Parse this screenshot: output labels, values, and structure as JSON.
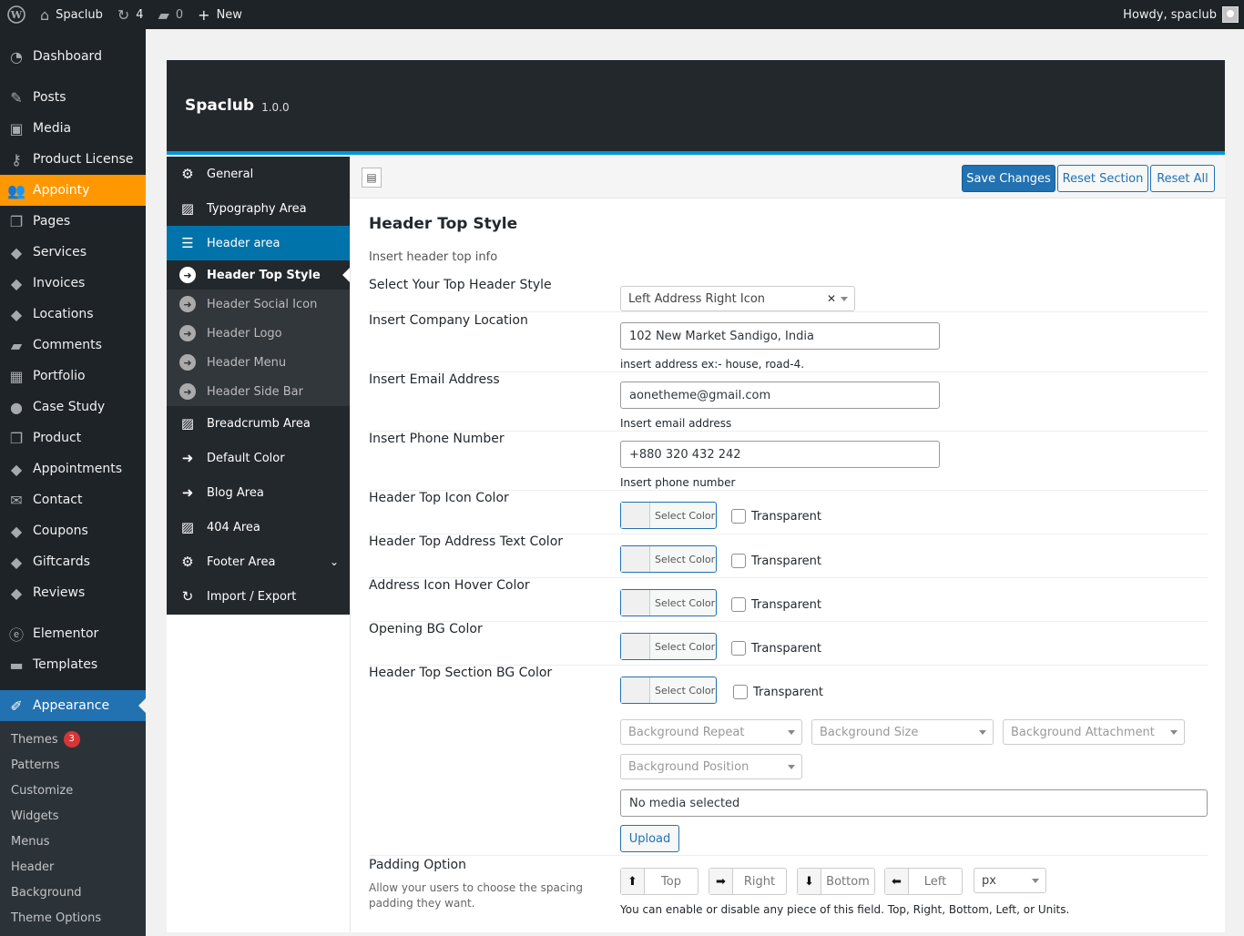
{
  "adminbar": {
    "site_name": "Spaclub",
    "updates_count": "4",
    "comments_count": "0",
    "new_label": "New",
    "howdy": "Howdy, spaclub"
  },
  "admin_menu": {
    "items": [
      {
        "label": "Dashboard",
        "icon": "dashboard-icon"
      },
      {
        "label": "Posts",
        "icon": "pin-icon"
      },
      {
        "label": "Media",
        "icon": "media-icon"
      },
      {
        "label": "Product License",
        "icon": "key-icon"
      },
      {
        "label": "Appointy",
        "icon": "users-icon"
      },
      {
        "label": "Pages",
        "icon": "pages-icon"
      },
      {
        "label": "Services",
        "icon": "tag-icon"
      },
      {
        "label": "Invoices",
        "icon": "tag-icon"
      },
      {
        "label": "Locations",
        "icon": "tag-icon"
      },
      {
        "label": "Comments",
        "icon": "comment-icon"
      },
      {
        "label": "Portfolio",
        "icon": "portfolio-icon"
      },
      {
        "label": "Case Study",
        "icon": "chat-icon"
      },
      {
        "label": "Product",
        "icon": "pages-icon"
      },
      {
        "label": "Appointments",
        "icon": "tag-icon"
      },
      {
        "label": "Contact",
        "icon": "mail-icon"
      },
      {
        "label": "Coupons",
        "icon": "tag-icon"
      },
      {
        "label": "Giftcards",
        "icon": "tag-icon"
      },
      {
        "label": "Reviews",
        "icon": "tag-icon"
      },
      {
        "label": "Elementor",
        "icon": "elementor-icon"
      },
      {
        "label": "Templates",
        "icon": "folder-icon"
      },
      {
        "label": "Appearance",
        "icon": "brush-icon"
      }
    ],
    "submenu": [
      {
        "label": "Themes",
        "badge": "3"
      },
      {
        "label": "Patterns"
      },
      {
        "label": "Customize"
      },
      {
        "label": "Widgets"
      },
      {
        "label": "Menus"
      },
      {
        "label": "Header"
      },
      {
        "label": "Background"
      },
      {
        "label": "Theme Options"
      }
    ]
  },
  "panel": {
    "title": "Spaclub",
    "version": "1.0.0",
    "sidebar": {
      "general": "General",
      "typography": "Typography Area",
      "header_area": "Header area",
      "sub": [
        "Header Top Style",
        "Header Social Icon",
        "Header Logo",
        "Header Menu",
        "Header Side Bar"
      ],
      "breadcrumb": "Breadcrumb Area",
      "default_color": "Default Color",
      "blog": "Blog Area",
      "area404": "404 Area",
      "footer": "Footer Area",
      "import_export": "Import / Export"
    },
    "toolbar": {
      "save": "Save Changes",
      "reset_section": "Reset Section",
      "reset_all": "Reset All"
    }
  },
  "section": {
    "title": "Header Top Style",
    "desc": "Insert header top info",
    "top_header_style": {
      "label": "Select Your Top Header Style",
      "value": "Left Address Right Icon"
    },
    "location": {
      "label": "Insert Company Location",
      "value": "102 New Market Sandigo, India",
      "hint": "insert address ex:- house, road-4."
    },
    "email": {
      "label": "Insert Email Address",
      "value": "aonetheme@gmail.com",
      "hint": "Insert email address"
    },
    "phone": {
      "label": "Insert Phone Number",
      "value": "+880 320 432 242",
      "hint": "Insert phone number"
    },
    "select_color": "Select Color",
    "transparent": "Transparent",
    "colors": [
      "Header Top Icon Color",
      "Header Top Address Text Color",
      "Address Icon Hover Color",
      "Opening BG Color",
      "Header Top Section BG Color"
    ],
    "bg": {
      "repeat": "Background Repeat",
      "size": "Background Size",
      "attachment": "Background Attachment",
      "position": "Background Position",
      "media": "No media selected",
      "upload": "Upload"
    },
    "padding": {
      "label": "Padding Option",
      "desc": "Allow your users to choose the spacing padding they want.",
      "top": "Top",
      "right": "Right",
      "bottom": "Bottom",
      "left": "Left",
      "unit": "px",
      "hint": "You can enable or disable any piece of this field. Top, Right, Bottom, Left, or Units."
    }
  }
}
